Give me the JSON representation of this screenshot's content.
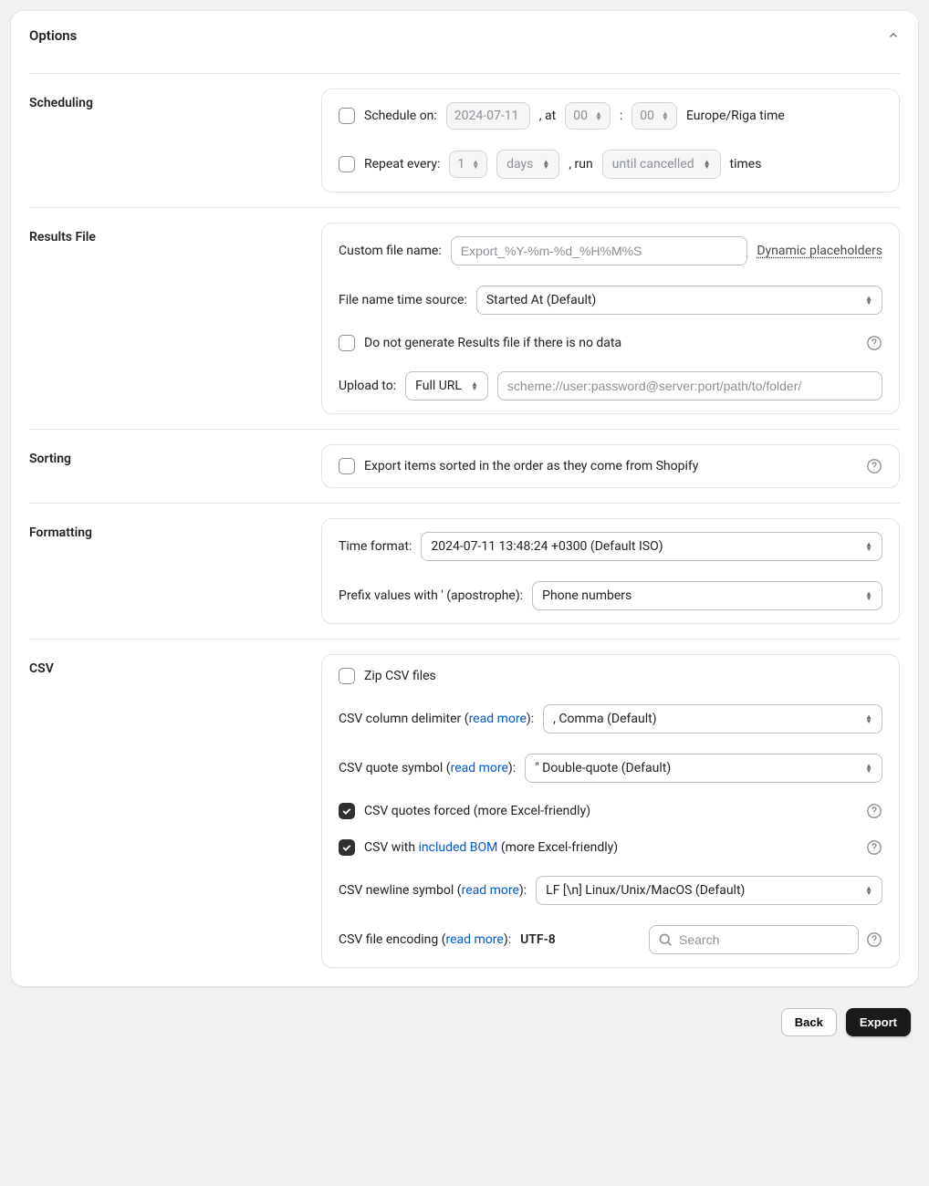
{
  "header": {
    "title": "Options"
  },
  "scheduling": {
    "label": "Scheduling",
    "schedule_on_label": "Schedule on:",
    "schedule_date": "2024-07-11",
    "at_label": ", at",
    "hour": "00",
    "colon": ":",
    "minute": "00",
    "tz": "Europe/Riga time",
    "repeat_label": "Repeat every:",
    "repeat_value": "1",
    "repeat_unit": "days",
    "run_label": ", run",
    "run_until": "until cancelled",
    "times_label": "times"
  },
  "results": {
    "label": "Results File",
    "custom_name_label": "Custom file name:",
    "custom_name_placeholder": "Export_%Y-%m-%d_%H%M%S",
    "dyn_placeholders": "Dynamic placeholders",
    "time_source_label": "File name time source:",
    "time_source_value": "Started At (Default)",
    "no_data_label": "Do not generate Results file if there is no data",
    "upload_label": "Upload to:",
    "upload_mode": "Full URL",
    "upload_placeholder": "scheme://user:password@server:port/path/to/folder/"
  },
  "sorting": {
    "label": "Sorting",
    "shopify_order_label": "Export items sorted in the order as they come from Shopify"
  },
  "formatting": {
    "label": "Formatting",
    "time_format_label": "Time format:",
    "time_format_value": "2024-07-11 13:48:24 +0300 (Default ISO)",
    "prefix_label": "Prefix values with ' (apostrophe):",
    "prefix_value": "Phone numbers"
  },
  "csv": {
    "label": "CSV",
    "zip_label": "Zip CSV files",
    "col_delim_label_a": "CSV column delimiter (",
    "read_more": "read more",
    "label_close": "):",
    "col_delim_value": ", Comma (Default)",
    "quote_label_a": "CSV quote symbol (",
    "quote_value": "\" Double-quote (Default)",
    "quotes_forced_label": "CSV quotes forced (more Excel-friendly)",
    "bom_label_a": "CSV with ",
    "bom_link": "included BOM",
    "bom_label_b": " (more Excel-friendly)",
    "newline_label_a": "CSV newline symbol (",
    "newline_value": "LF [\\n] Linux/Unix/MacOS (Default)",
    "encoding_label_a": "CSV file encoding (",
    "encoding_value": "UTF-8",
    "search_placeholder": "Search"
  },
  "footer": {
    "back": "Back",
    "export": "Export"
  }
}
